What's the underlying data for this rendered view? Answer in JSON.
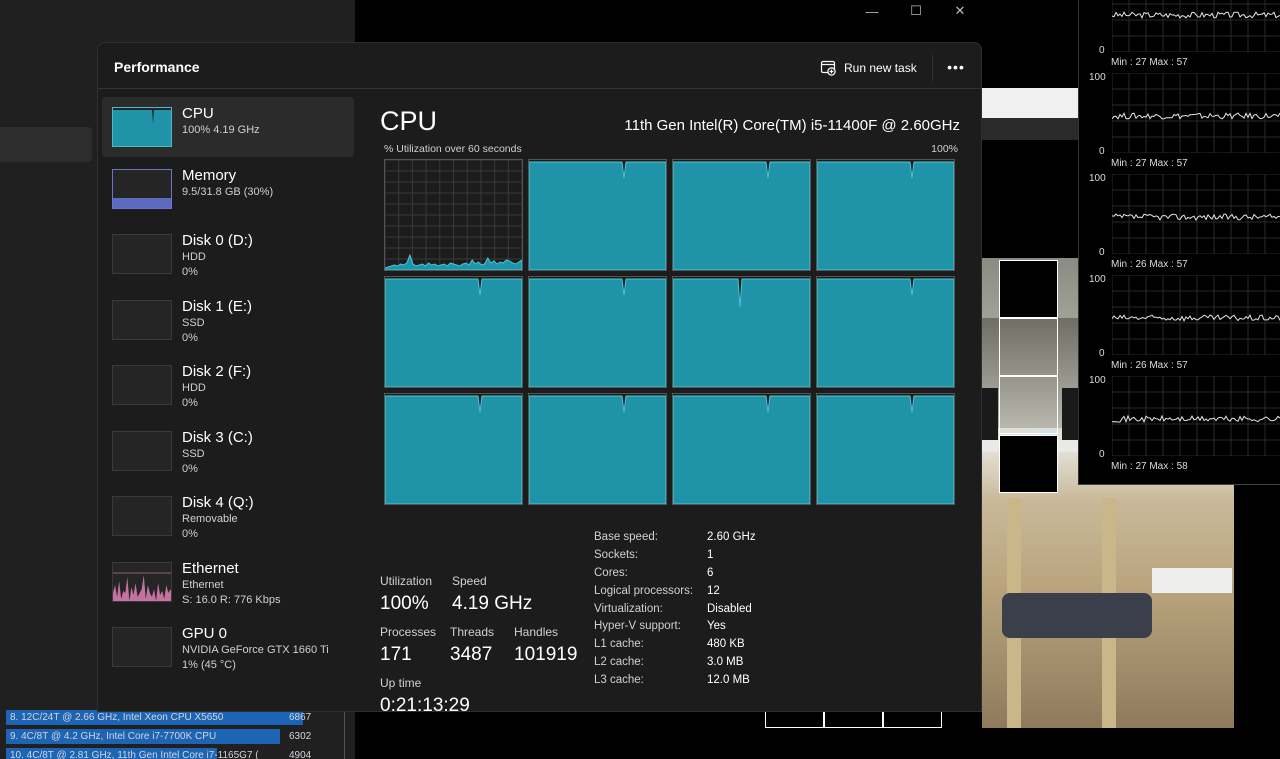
{
  "background": {
    "list": [
      {
        "label": "8. 12C/24T @ 2.66 GHz, Intel Xeon CPU X5650",
        "score": "6867",
        "fill": 0.9
      },
      {
        "label": "9. 4C/8T @ 4.2 GHz, Intel Core i7-7700K CPU",
        "score": "6302",
        "fill": 0.83
      },
      {
        "label": "10. 4C/8T @ 2.81 GHz, 11th Gen Intel Core i7-1165G7 (",
        "score": "4904",
        "fill": 0.64
      }
    ]
  },
  "core_monitor": {
    "max_label": "100",
    "zero_label": "0",
    "graphs": [
      {
        "min_max": "Min : 27   Max : 57"
      },
      {
        "min_max": "Min : 27   Max : 57"
      },
      {
        "min_max": "Min : 26   Max : 57"
      },
      {
        "min_max": "Min : 26   Max : 57"
      },
      {
        "min_max": "Min : 27   Max : 58"
      }
    ]
  },
  "window": {
    "title": "Performance",
    "run_task_label": "Run new task",
    "more_label": "•••",
    "caption": {
      "minimize": "—",
      "maximize": "☐",
      "close": "✕"
    }
  },
  "sidebar": {
    "items": [
      {
        "name": "CPU",
        "line2": "100% 4.19 GHz",
        "line3": "",
        "kind": "cpu",
        "active": true
      },
      {
        "name": "Memory",
        "line2": "9.5/31.8 GB (30%)",
        "line3": "",
        "kind": "memory",
        "active": false
      },
      {
        "name": "Disk 0 (D:)",
        "line2": "HDD",
        "line3": "0%",
        "kind": "disk",
        "active": false
      },
      {
        "name": "Disk 1 (E:)",
        "line2": "SSD",
        "line3": "0%",
        "kind": "disk",
        "active": false
      },
      {
        "name": "Disk 2 (F:)",
        "line2": "HDD",
        "line3": "0%",
        "kind": "disk",
        "active": false
      },
      {
        "name": "Disk 3 (C:)",
        "line2": "SSD",
        "line3": "0%",
        "kind": "disk",
        "active": false
      },
      {
        "name": "Disk 4 (Q:)",
        "line2": "Removable",
        "line3": "0%",
        "kind": "disk",
        "active": false
      },
      {
        "name": "Ethernet",
        "line2": "Ethernet",
        "line3": "S: 16.0  R: 776 Kbps",
        "kind": "ethernet",
        "active": false
      },
      {
        "name": "GPU 0",
        "line2": "NVIDIA GeForce GTX 1660 Ti",
        "line3": "1% (45 °C)",
        "kind": "gpu",
        "active": false
      }
    ]
  },
  "cpu": {
    "title": "CPU",
    "model": "11th Gen Intel(R) Core(TM) i5-11400F @ 2.60GHz",
    "graph_label": "% Utilization over 60 seconds",
    "graph_max": "100%",
    "core_count": 12,
    "first_core_util": 0.05,
    "stats": {
      "utilization": {
        "label": "Utilization",
        "value": "100%"
      },
      "speed": {
        "label": "Speed",
        "value": "4.19 GHz"
      },
      "processes": {
        "label": "Processes",
        "value": "171"
      },
      "threads": {
        "label": "Threads",
        "value": "3487"
      },
      "handles": {
        "label": "Handles",
        "value": "101919"
      },
      "uptime": {
        "label": "Up time",
        "value": "0:21:13:29"
      }
    },
    "specs": [
      {
        "k": "Base speed:",
        "v": "2.60 GHz"
      },
      {
        "k": "Sockets:",
        "v": "1"
      },
      {
        "k": "Cores:",
        "v": "6"
      },
      {
        "k": "Logical processors:",
        "v": "12"
      },
      {
        "k": "Virtualization:",
        "v": "Disabled"
      },
      {
        "k": "Hyper-V support:",
        "v": "Yes"
      },
      {
        "k": "L1 cache:",
        "v": "480 KB"
      },
      {
        "k": "L2 cache:",
        "v": "3.0 MB"
      },
      {
        "k": "L3 cache:",
        "v": "12.0 MB"
      }
    ]
  },
  "colors": {
    "cpu_fill": "#1f94a8",
    "cpu_line": "#4fc3d6",
    "memory_fill": "#5c6bc0",
    "ethernet": "#e080b8",
    "graph_border": "#555555",
    "accent": "#2b2b2b"
  }
}
